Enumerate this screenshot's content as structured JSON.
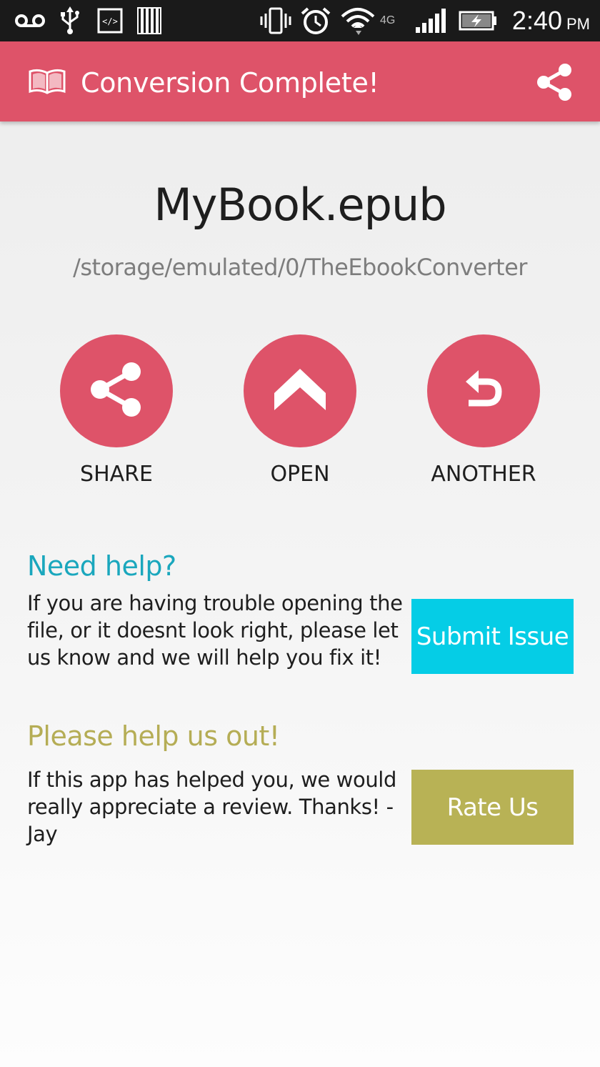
{
  "status_bar": {
    "time": "2:40",
    "ampm": "PM",
    "network_label": "4G",
    "icons": [
      "voicemail-icon",
      "usb-icon",
      "developer-icon",
      "storage-icon",
      "vibrate-icon",
      "alarm-icon",
      "wifi-icon",
      "signal-icon",
      "battery-charging-icon"
    ]
  },
  "app_bar": {
    "title": "Conversion Complete!",
    "logo_icon": "open-book-icon",
    "action_icon": "share-icon"
  },
  "file": {
    "name": "MyBook.epub",
    "path": "/storage/emulated/0/TheEbookConverter"
  },
  "actions": [
    {
      "label": "SHARE",
      "icon": "share-icon"
    },
    {
      "label": "OPEN",
      "icon": "chevron-up-icon"
    },
    {
      "label": "ANOTHER",
      "icon": "undo-icon"
    }
  ],
  "help": {
    "title": "Need help?",
    "body": "If you are having trouble opening the file, or it doesnt look right, please let us know and we will help you fix it!",
    "button_label": "Submit Issue"
  },
  "rate": {
    "title": "Please help us out!",
    "body": "If this app has helped you, we would really appreciate a review. Thanks! - Jay",
    "button_label": "Rate Us"
  },
  "colors": {
    "accent": "#de5369",
    "help": "#1aa7bd",
    "submit_button": "#05cde6",
    "rate": "#b5ad55",
    "status_bar": "#1a1a1a"
  }
}
